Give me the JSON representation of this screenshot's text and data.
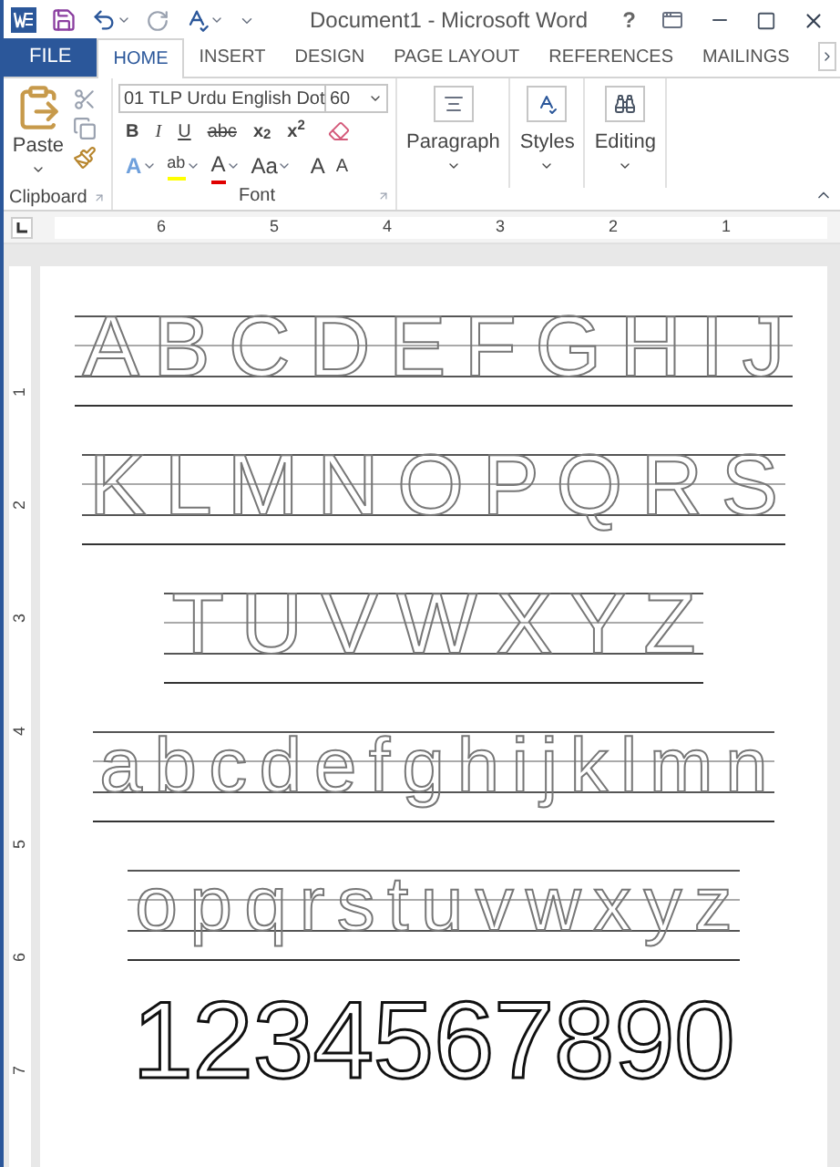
{
  "title_bar": {
    "title": "Document1 - Microsoft Word",
    "help": "?"
  },
  "tabs": [
    {
      "label": "FILE",
      "kind": "file",
      "selected": false
    },
    {
      "label": "HOME",
      "kind": "tab",
      "selected": true
    },
    {
      "label": "INSERT",
      "kind": "tab",
      "selected": false
    },
    {
      "label": "DESIGN",
      "kind": "tab",
      "selected": false
    },
    {
      "label": "PAGE LAYOUT",
      "kind": "tab",
      "selected": false
    },
    {
      "label": "REFERENCES",
      "kind": "tab",
      "selected": false
    },
    {
      "label": "MAILINGS",
      "kind": "tab",
      "selected": false
    }
  ],
  "ribbon": {
    "paste": "Paste",
    "clipboard_group": "Clipboard",
    "font_name": "01 TLP Urdu English Dot",
    "font_size": "60",
    "font_buttons": [
      "B",
      "I",
      "U",
      "abc",
      "x$_{2}$",
      "x$^{2}$"
    ],
    "effect_buttons": [
      "A",
      "ab",
      "A",
      "Aa"
    ],
    "size_buttons": [
      "A",
      "A"
    ],
    "font_group": "Font",
    "paragraph": "Paragraph",
    "styles": "Styles",
    "editing": "Editing"
  },
  "ruler": {
    "marks": [
      "6",
      "5",
      "4",
      "3",
      "2",
      "1"
    ]
  },
  "vertical_ruler": {
    "marks": [
      "1",
      "2",
      "3",
      "4",
      "5",
      "6",
      "7"
    ]
  },
  "document": {
    "rows": [
      {
        "text": "A B C D E F G H I J",
        "kind": "capitals"
      },
      {
        "text": "K L M N O P Q R S",
        "kind": "capitals"
      },
      {
        "text": "T U V W X Y Z",
        "kind": "capitals"
      },
      {
        "text": "a b c d e f g h i j k l m n",
        "kind": "small"
      },
      {
        "text": "o p q r s t u v w x y z",
        "kind": "small"
      },
      {
        "text": "1 2 3 4 5 6 7 8 9 0",
        "kind": "numbers"
      }
    ]
  }
}
